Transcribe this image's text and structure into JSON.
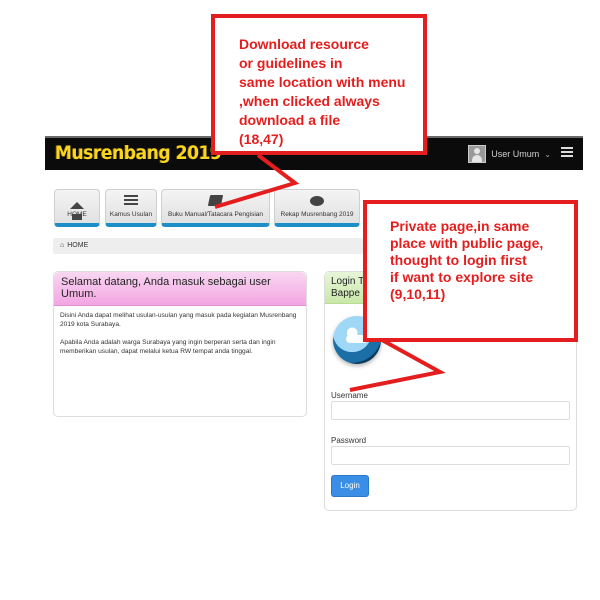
{
  "header": {
    "logo_text": "Musrenbang 2019",
    "user_label": "User Umum",
    "user_caret": "⌄"
  },
  "menu": {
    "items": [
      {
        "label": "HOME",
        "icon": "home-icon"
      },
      {
        "label": "Kamus Usulan",
        "icon": "list-icon"
      },
      {
        "label": "Buku Manual/Tatacara Pengisian",
        "icon": "book-icon"
      },
      {
        "label": "Rekap Musrenbang 2019",
        "icon": "chat-icon"
      }
    ]
  },
  "breadcrumb": {
    "icon": "home-icon",
    "label": "HOME"
  },
  "welcome": {
    "title": "Selamat datang, Anda masuk sebagai user Umum.",
    "paragraph1": "Disini Anda dapat melihat usulan-usulan yang masuk pada kegiatan Musrenbang 2019 kota Surabaya.",
    "paragraph2": "Apabila Anda adalah warga Surabaya yang ingin berperan serta dan ingin memberikan usulan, dapat melalui ketua RW tempat anda tinggal."
  },
  "login": {
    "title": "Login T\nBappe",
    "username_label": "Username",
    "password_label": "Password",
    "button_label": "Login"
  },
  "annotations": {
    "callout1": "Download resource\nor guidelines in\nsame location with menu\n,when clicked always\ndownload a file\n(18,47)",
    "callout2": "Private page,in same\nplace with public page,\nthought to login first\nif want to explore site\n(9,10,11)"
  },
  "colors": {
    "annotation_red": "#e41e1e",
    "tile_accent": "#1c8fc9",
    "login_button": "#3a8ee6",
    "welcome_header": "#f3a5e2",
    "login_header": "#c9e8a9",
    "logo_yellow": "#f7d520"
  }
}
